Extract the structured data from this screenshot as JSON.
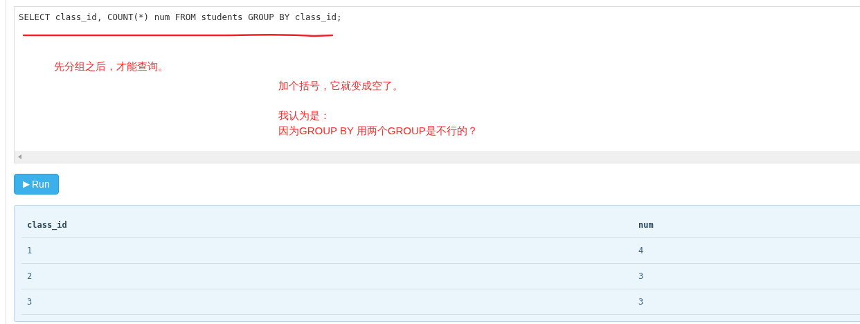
{
  "editor": {
    "code": "SELECT class_id, COUNT(*) num FROM students GROUP BY class_id;"
  },
  "annotations": [
    {
      "text": "先分组之后，才能查询。"
    },
    {
      "text": "加个括号，它就变成空了。"
    },
    {
      "text": "我认为是："
    },
    {
      "text": "因为GROUP BY 用两个GROUP是不行的？"
    }
  ],
  "run_button": {
    "icon": "▶",
    "label": "Run"
  },
  "results": {
    "columns": [
      "class_id",
      "num"
    ],
    "rows": [
      [
        "1",
        "4"
      ],
      [
        "2",
        "3"
      ],
      [
        "3",
        "3"
      ]
    ]
  }
}
